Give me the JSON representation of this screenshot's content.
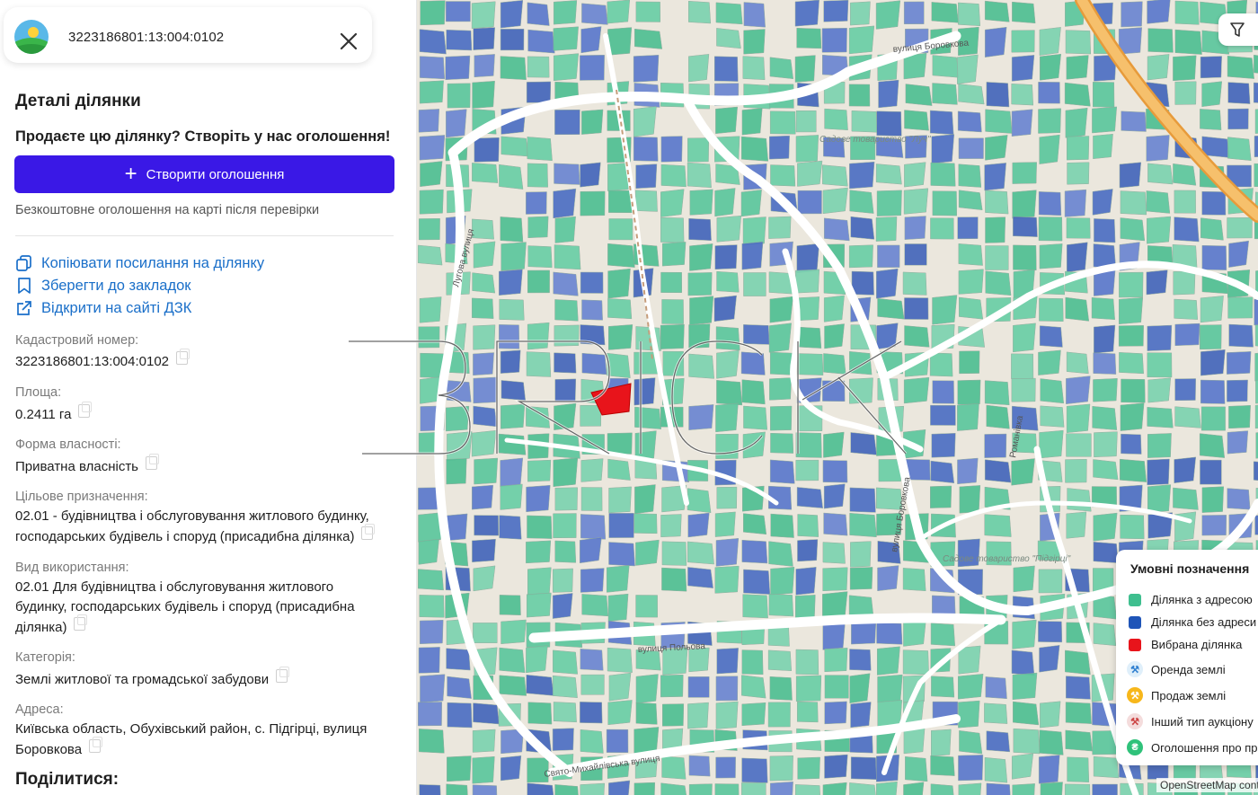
{
  "search": {
    "value": "3223186801:13:004:0102"
  },
  "panel": {
    "title": "Деталі ділянки",
    "promo": "Продаєте цю ділянку? Створіть у нас оголошення!",
    "create_button": "Створити оголошення",
    "free_note": "Безкоштовне оголошення на карті після перевірки",
    "actions": {
      "copy_link": "Копіювати посилання на ділянку",
      "bookmark": "Зберегти до закладок",
      "open_dzk": "Відкрити на сайті ДЗК"
    },
    "fields": {
      "cadastral": {
        "label": "Кадастровий номер:",
        "value": "3223186801:13:004:0102"
      },
      "area": {
        "label": "Площа:",
        "value": "0.2411 га"
      },
      "ownership": {
        "label": "Форма власності:",
        "value": "Приватна власність"
      },
      "purpose": {
        "label": "Цільове призначення:",
        "value": "02.01 - будівництва і обслуговування житлового будинку, господарських будівель і споруд (присадибна ділянка)"
      },
      "usage": {
        "label": "Вид використання:",
        "value": "02.01 Для будівництва і обслуговування житлового будинку, господарських будівель і споруд (присадибна ділянка)"
      },
      "category": {
        "label": "Категорія:",
        "value": "Землі житлової та громадської забудови"
      },
      "address": {
        "label": "Адреса:",
        "value": "Київська область, Обухівський район, с. Підгірці, вулиця Боровкова"
      }
    },
    "share_title": "Поділитися:"
  },
  "map": {
    "streets": [
      "вулиця Боровкова",
      "Лугова вулиця",
      "вулиця Польова",
      "Свято-Михайлівська вулиця",
      "вулиця Боровкова",
      "Романівка"
    ],
    "places": [
      "Садове товариство \"Луч\"",
      "Садове товариство \"Підгірці\""
    ],
    "filter_label": "Ф"
  },
  "legend": {
    "title": "Умовні позначення",
    "items": [
      {
        "label": "Ділянка з адресою",
        "color": "#3fbf8f"
      },
      {
        "label": "Ділянка без адреси",
        "color": "#1f55b8"
      },
      {
        "label": "Вибрана ділянка",
        "color": "#e8141b"
      },
      {
        "label": "Оренда землі",
        "icon": "rent-icon"
      },
      {
        "label": "Продаж землі",
        "icon": "sale-icon"
      },
      {
        "label": "Інший тип аукціону",
        "icon": "auction-icon"
      },
      {
        "label": "Оголошення про продаж",
        "icon": "hryvnia-icon"
      }
    ]
  },
  "attribution": "OpenStreetMap contributors",
  "colors": {
    "accent": "#3a18e6",
    "link": "#1a6fc9",
    "with_address": "#5cc79e",
    "without_address": "#4d6fc4",
    "selected": "#e8141b"
  }
}
